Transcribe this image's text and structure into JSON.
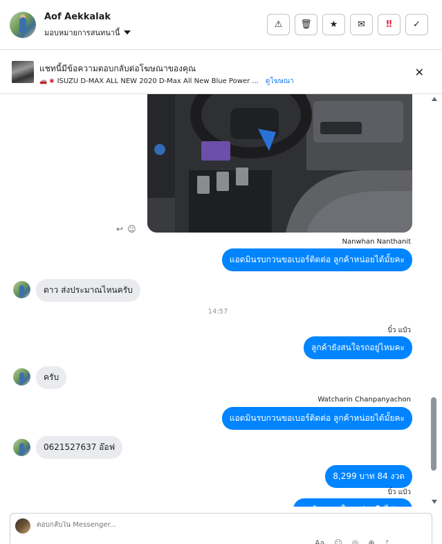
{
  "header": {
    "contact_name": "Aof Aekkalak",
    "assign_label": "มอบหมายการสนทนานี้",
    "actions": [
      {
        "icon": "warning-icon",
        "glyph": "⚠"
      },
      {
        "icon": "trash-icon",
        "glyph": "🗑"
      },
      {
        "icon": "star-icon",
        "glyph": "★"
      },
      {
        "icon": "mail-icon",
        "glyph": "✉"
      },
      {
        "icon": "important-icon",
        "glyph": "‼"
      },
      {
        "icon": "check-icon",
        "glyph": "✓"
      }
    ]
  },
  "ad_banner": {
    "title": "แชทนี้มีข้อความตอบกลับต่อโฆษณาของคุณ",
    "emojis": "🚗 ✱",
    "ad_text": "ISUZU D-MAX ALL NEW 2020 D-Max All New Blue Power ...",
    "link_label": "ดูโฆษณา",
    "close_glyph": "✕"
  },
  "messages": {
    "msg_icons": {
      "reply": "↩",
      "react": "☺"
    },
    "sender_1": "Nanwhan Nanthanit",
    "out_1": "แอดมินรบกวนขอเบอร์ติดต่อ ลูกค้าหน่อยได้มั้ยคะ",
    "in_1": "ดาว ส่งประมาณไหนครับ",
    "time_1": "14:57",
    "sender_2": "บิ๋ว แป๋ว",
    "out_2": "ลูกค้ายังสนใจรถอยู่ไหมคะ",
    "in_2": "ครับ",
    "sender_3": "Watcharin Chanpanyachon",
    "out_3": "แอดมินรบกวนขอเบอร์ติดต่อ ลูกค้าหน่อยได้มั้ยคะ",
    "in_3": "0621527637 อ๊อฟ",
    "out_4": "8,299 บาท  84 งวด",
    "sender_4": "บิ๋ว แป๋ว",
    "out_5": "ลูกค้าจะสนใจรถต่อหรือไม่คะ"
  },
  "composer": {
    "placeholder": "ตอบกลับใน Messenger...",
    "tools": [
      "Aa",
      "☺",
      "◎",
      "⊕",
      "♪"
    ]
  }
}
